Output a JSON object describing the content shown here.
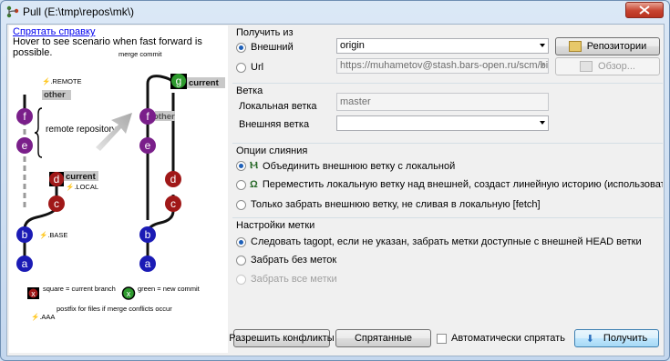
{
  "window": {
    "title": "Pull (E:\\tmp\\repos\\mk\\)"
  },
  "help": {
    "hide_link": "Спрятать справку",
    "hint": "Hover to see scenario when fast forward is possible.",
    "diagram": {
      "merge_commit": "merge commit",
      "remote_tag": "⚡.REMOTE",
      "remote_branch": "other",
      "remote_repository": "remote repository",
      "local_branch": "current",
      "local_tag": "⚡.LOCAL",
      "base_tag": "⚡.BASE",
      "merged_branch_other": "other",
      "merged_branch_current": "current",
      "commits": {
        "a": "a",
        "b": "b",
        "c": "c",
        "d": "d",
        "e": "e",
        "f": "f",
        "g": "g"
      },
      "legend_square": "square = current branch",
      "legend_green": "green = new commit",
      "legend_postfix_tag": "⚡.AAA",
      "legend_postfix": "postfix for files if merge conflicts occur"
    }
  },
  "source": {
    "title": "Получить из",
    "remote_label": "Внешний",
    "remote_value": "origin",
    "repos_button": "Репозитории",
    "url_label": "Url",
    "url_value": "https://muhametov@stash.bars-open.ru/scm/bifs/m",
    "browse_button": "Обзор..."
  },
  "branch": {
    "title": "Ветка",
    "local_label": "Локальная ветка",
    "local_value": "master",
    "remote_label": "Внешняя ветка",
    "remote_value": ""
  },
  "merge": {
    "title": "Опции слияния",
    "opt_merge": "Объединить внешнюю ветку с локальной",
    "opt_rebase": "Переместить локальную ветку над внешней, создаст линейную историю (использовать с осторожност",
    "opt_fetch": "Только забрать внешнюю ветку, не сливая в локальную [fetch]"
  },
  "tags": {
    "title": "Настройки метки",
    "opt_tagopt": "Следовать tagopt, если не указан, забрать метки доступные с внешней HEAD ветки",
    "opt_no_tags": "Забрать без меток",
    "opt_all_tags": "Забрать все метки"
  },
  "buttons": {
    "resolve": "Разрешить конфликты",
    "stashed": "Спрятанные",
    "autostash": "Автоматически спрятать",
    "pull": "Получить"
  }
}
